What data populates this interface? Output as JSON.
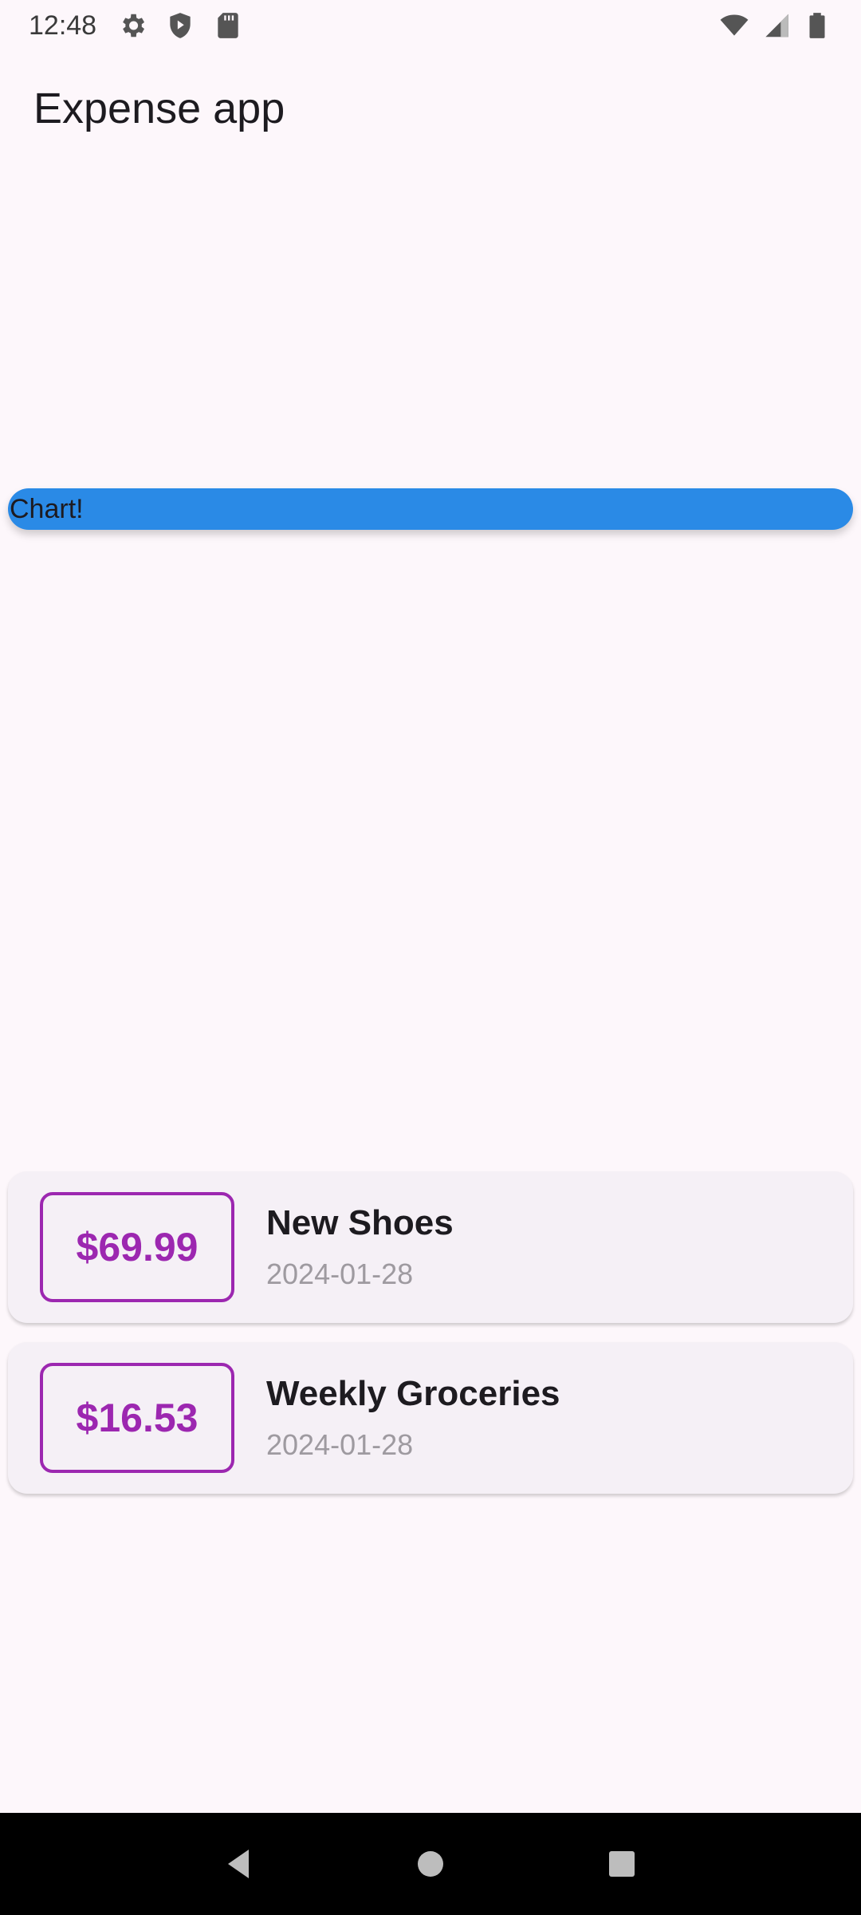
{
  "status_bar": {
    "time": "12:48",
    "left_icons": [
      "gear-icon",
      "shield-play-icon",
      "sd-card-icon"
    ],
    "right_icons": [
      "wifi-icon",
      "cell-signal-icon",
      "battery-icon"
    ]
  },
  "app_bar": {
    "title": "Expense app"
  },
  "chart": {
    "label": "Chart!",
    "color": "#2a8ae6"
  },
  "expenses": [
    {
      "amount": "$69.99",
      "title": "New Shoes",
      "date": "2024-01-28"
    },
    {
      "amount": "$16.53",
      "title": "Weekly Groceries",
      "date": "2024-01-28"
    }
  ],
  "colors": {
    "accent": "#9c27b0",
    "background": "#fdf7fb",
    "card": "#f5f0f6"
  },
  "nav_bar": {
    "buttons": [
      "back-icon",
      "home-icon",
      "recents-icon"
    ]
  }
}
